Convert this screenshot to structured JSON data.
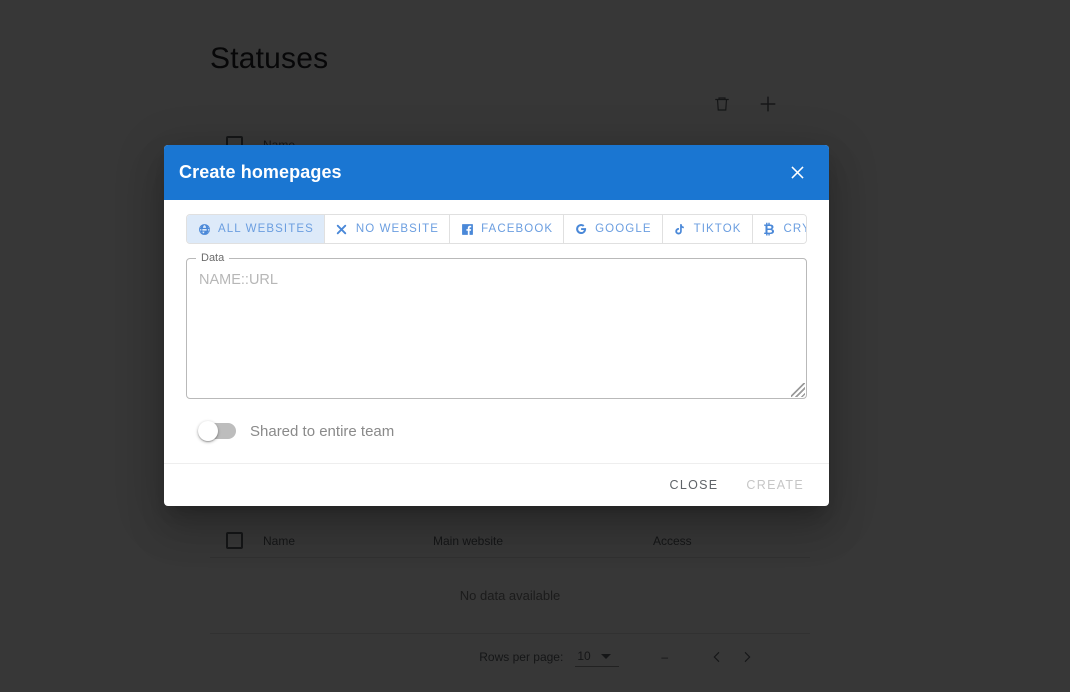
{
  "background": {
    "page_title": "Statuses",
    "toolbar": {
      "delete_icon": "trash-icon",
      "add_icon": "plus-icon"
    },
    "top_table": {
      "columns": [
        "Name"
      ]
    },
    "bottom_table": {
      "columns": [
        "Name",
        "Main website",
        "Access"
      ],
      "empty_message": "No data available"
    },
    "pagination": {
      "rows_per_page_label": "Rows per page:",
      "rows_per_page_value": "10",
      "range_display": "–",
      "prev_icon": "chevron-left-icon",
      "next_icon": "chevron-right-icon"
    }
  },
  "dialog": {
    "title": "Create homepages",
    "close_icon": "close-icon",
    "tabs": [
      {
        "label": "ALL WEBSITES",
        "icon": "globe-icon",
        "selected": true
      },
      {
        "label": "NO WEBSITE",
        "icon": "x-icon",
        "selected": false
      },
      {
        "label": "FACEBOOK",
        "icon": "facebook-icon",
        "selected": false
      },
      {
        "label": "GOOGLE",
        "icon": "google-icon",
        "selected": false
      },
      {
        "label": "TIKTOK",
        "icon": "tiktok-icon",
        "selected": false
      },
      {
        "label": "CRYPTO",
        "icon": "bitcoin-icon",
        "selected": false
      }
    ],
    "data_field": {
      "legend": "Data",
      "value": "",
      "placeholder": "NAME::URL"
    },
    "share_toggle": {
      "label": "Shared to entire team",
      "checked": false
    },
    "footer": {
      "close_label": "CLOSE",
      "create_label": "CREATE",
      "create_disabled": true
    }
  },
  "colors": {
    "header_blue": "#1a76d2",
    "tab_blue": "#6b9ee0",
    "tab_selected_bg": "#ddeaf9",
    "overlay": "rgba(0,0,0,0.78)"
  }
}
